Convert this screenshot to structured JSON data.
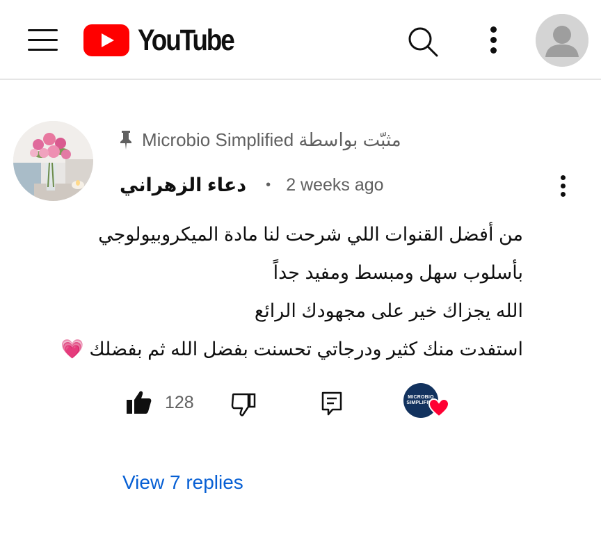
{
  "header": {
    "logo_text": "YouTube",
    "brand_color": "#ff0000",
    "icons": [
      "menu-icon",
      "search-icon",
      "more-vertical-icon",
      "account-icon"
    ]
  },
  "comment": {
    "pinned_text": "مثبّت بواسطة Microbio Simplified",
    "author": "دعاء الزهراني",
    "separator": "•",
    "time": "2 weeks ago",
    "lines": [
      "من أفضل القنوات اللي شرحت لنا مادة الميكروبيولوجي",
      "بأسلوب سهل ومبسط ومفيد جداً",
      "الله يجزاك خير على مجهودك الرائع",
      "استفدت منك كثير ودرجاتي تحسنت بفضل الله ثم بفضلك 💗"
    ],
    "like_count": "128",
    "creator_badge_line1": "MICROBIO",
    "creator_badge_line2": "SIMPLIFIED"
  },
  "replies": {
    "label": "View 7 replies"
  }
}
